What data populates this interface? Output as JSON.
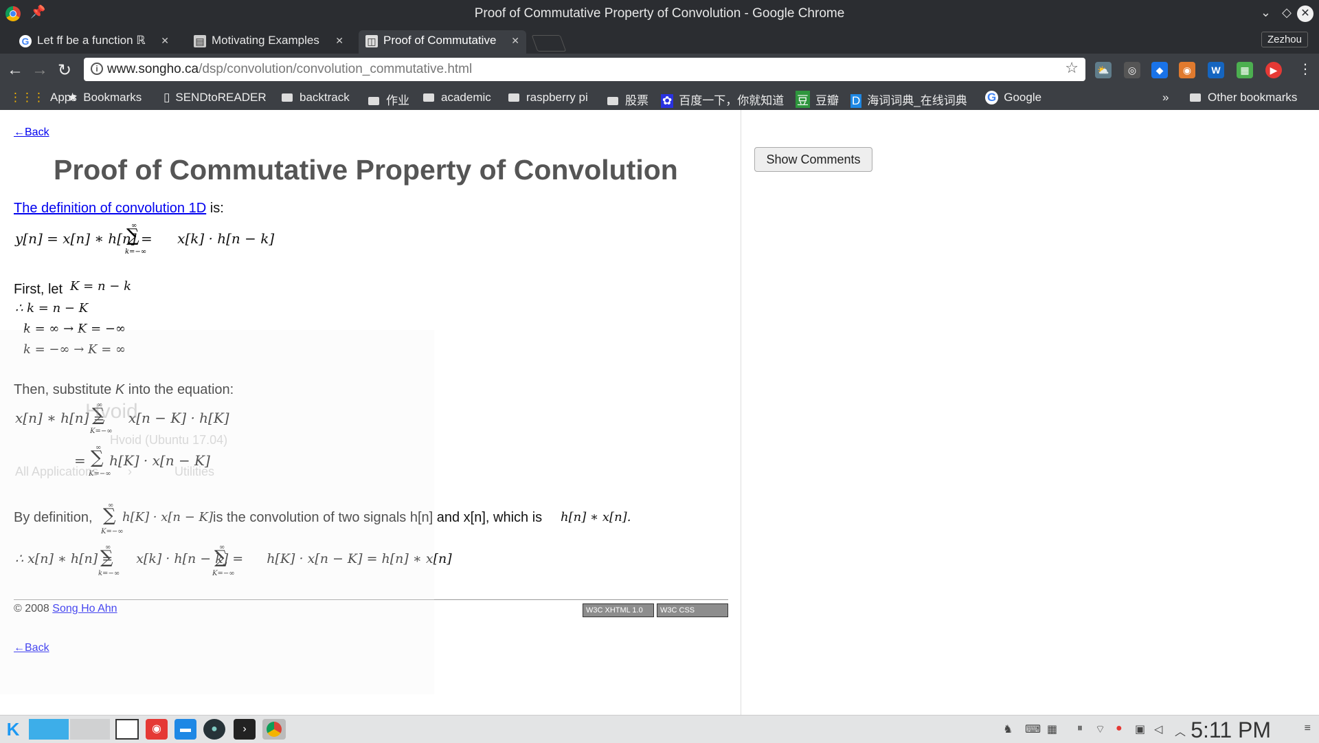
{
  "window": {
    "title": "Proof of Commutative Property of Convolution - Google Chrome",
    "profile": "Zezhou"
  },
  "tabs": [
    {
      "label": "Let ff be a function ℝ",
      "favicon": "google-icon"
    },
    {
      "label": "Motivating Examples",
      "favicon": "book-icon"
    },
    {
      "label": "Proof of Commutative",
      "favicon": "page-icon"
    }
  ],
  "omnibox": {
    "domain": "www.songho.ca",
    "path": "/dsp/convolution/convolution_commutative.html"
  },
  "bookmarks": [
    {
      "label": "Apps",
      "icon": "apps-grid-icon"
    },
    {
      "label": "Bookmarks",
      "icon": "star-icon"
    },
    {
      "label": "SENDtoREADER",
      "icon": "page-icon"
    },
    {
      "label": "backtrack",
      "icon": "folder-icon"
    },
    {
      "label": "作业",
      "icon": "folder-icon"
    },
    {
      "label": "academic",
      "icon": "folder-icon"
    },
    {
      "label": "raspberry pi",
      "icon": "folder-icon"
    },
    {
      "label": "股票",
      "icon": "folder-icon"
    },
    {
      "label": "百度一下，你就知道",
      "icon": "baidu-icon"
    },
    {
      "label": "豆瓣",
      "icon": "douban-icon"
    },
    {
      "label": "海词词典_在线词典",
      "icon": "dict-icon"
    },
    {
      "label": "Google",
      "icon": "google-icon"
    }
  ],
  "bookmarks_more": "»",
  "bookmarks_other": "Other bookmarks",
  "page": {
    "back_link": "←Back",
    "title": "Proof of Commutative Property of Convolution",
    "definition_link": "The definition of convolution 1D",
    "definition_suffix": " is:",
    "eq_definition": "y[n] = x[n] ∗ h[n] = ",
    "eq_definition_term": "x[k] · h[n − k]",
    "first_let": "First, let",
    "let_expr": "K = n − k",
    "step1": "∴ k = n − K",
    "step2": "k = ∞ → K = −∞",
    "step3": "k = −∞ → K = ∞",
    "then_text_1": "Then, substitute ",
    "then_text_var": "K",
    "then_text_2": " into the equation:",
    "eq_sub1_lhs": "x[n] ∗ h[n] = ",
    "eq_sub1_term": "x[n − K] · h[K]",
    "eq_sub2_lhs": "= ",
    "eq_sub2_term": "h[K] · x[n − K]",
    "bydef_1": "By definition,",
    "bydef_term": "h[K] · x[n − K]",
    "bydef_2": "is the convolution of two signals h[n] and x[n], which is",
    "bydef_result": "h[n] ∗ x[n].",
    "final_lhs": "∴ x[n] ∗ h[n] = ",
    "final_t1": "x[k] · h[n − k] = ",
    "final_t2": "h[K] · x[n − K] = h[n] ∗ x[n]",
    "sum_upper": "∞",
    "sum_lower_k": "k=−∞",
    "sum_lower_K": "K=−∞",
    "copyright_prefix": "© 2008 ",
    "author_link": "Song Ho Ahn",
    "badge_xhtml": "W3C XHTML 1.0",
    "badge_css": "W3C CSS",
    "show_comments": "Show Comments"
  },
  "overlay": {
    "app_name": "Hvoid",
    "subtitle": "Hvoid (Ubuntu 17.04)",
    "left_menu": "All Applications",
    "right_menu": "Utilities"
  },
  "taskbar": {
    "clock": "5:11 PM"
  }
}
